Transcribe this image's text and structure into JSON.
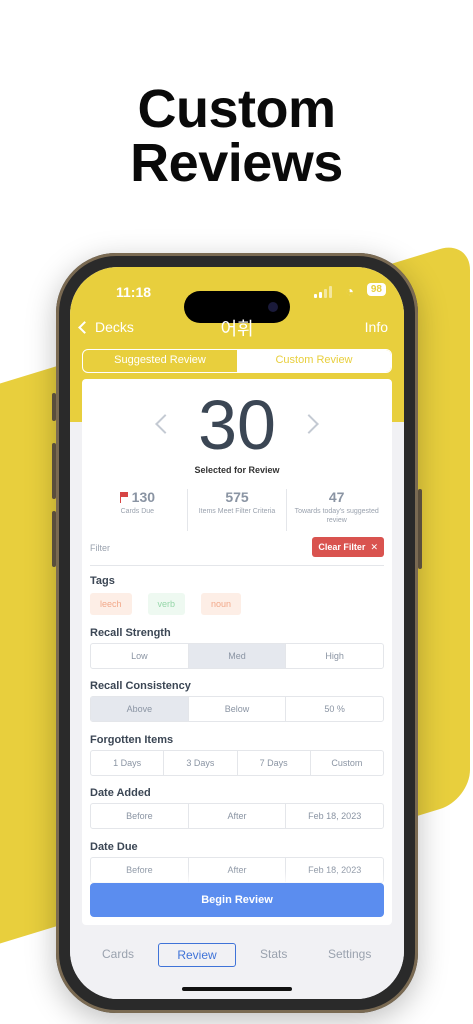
{
  "headline": {
    "line1": "Custom",
    "line2": "Reviews"
  },
  "status_bar": {
    "time": "11:18",
    "wifi_glyph": "◔",
    "battery": "98"
  },
  "nav": {
    "back_label": "Decks",
    "title": "어휘",
    "info_label": "Info"
  },
  "review_mode": {
    "tabs": [
      "Suggested Review",
      "Custom Review"
    ],
    "selected": "Custom Review"
  },
  "counter": {
    "value": "30",
    "caption": "Selected for Review"
  },
  "stats": [
    {
      "value": "130",
      "label": "Cards Due"
    },
    {
      "value": "575",
      "label": "Items Meet Filter Criteria"
    },
    {
      "value": "47",
      "label": "Towards today's suggested review"
    }
  ],
  "filter": {
    "label": "Filter",
    "clear_label": "Clear Filter",
    "clear_glyph": "✕"
  },
  "tags": {
    "title": "Tags",
    "items": [
      "leech",
      "verb",
      "noun"
    ]
  },
  "recall_strength": {
    "title": "Recall Strength",
    "options": [
      "Low",
      "Med",
      "High"
    ],
    "selected": "Med"
  },
  "recall_consistency": {
    "title": "Recall Consistency",
    "options": [
      "Above",
      "Below",
      "50 %"
    ],
    "selected": "Above"
  },
  "forgotten_items": {
    "title": "Forgotten Items",
    "options": [
      "1 Days",
      "3 Days",
      "7 Days",
      "Custom"
    ]
  },
  "date_added": {
    "title": "Date Added",
    "options": [
      "Before",
      "After",
      "Feb 18, 2023"
    ]
  },
  "date_due": {
    "title": "Date Due",
    "options": [
      "Before",
      "After",
      "Feb 18, 2023"
    ]
  },
  "begin_button": "Begin Review",
  "tab_bar": {
    "tabs": [
      "Cards",
      "Review",
      "Stats",
      "Settings"
    ],
    "active": "Review"
  },
  "colors": {
    "accent_yellow": "#e8cf3d",
    "primary_blue": "#5b8def",
    "danger_red": "#d9534f"
  }
}
